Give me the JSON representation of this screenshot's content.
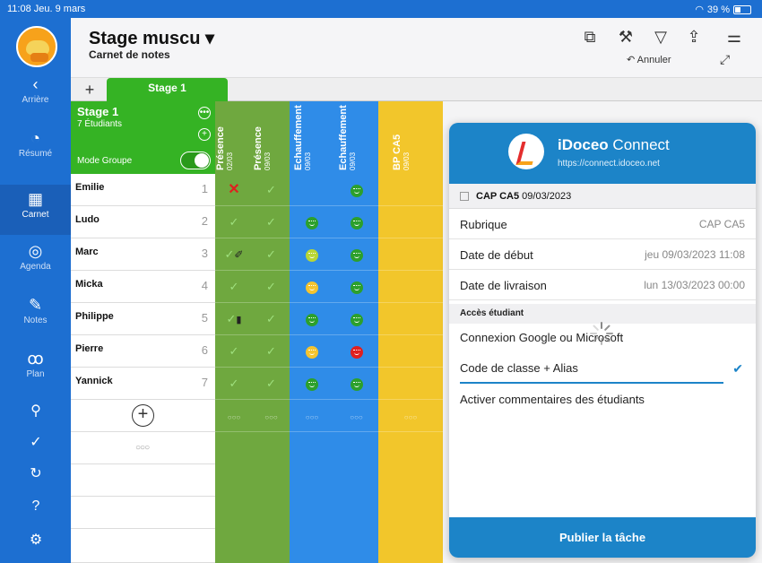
{
  "status": {
    "time": "11:08",
    "date": "Jeu. 9 mars",
    "battery": "39 %"
  },
  "sidebar": {
    "items": [
      {
        "label": "Arrière",
        "icon": "‹"
      },
      {
        "label": "Résumé",
        "icon": "◔"
      },
      {
        "label": "Carnet",
        "icon": "▦"
      },
      {
        "label": "Agenda",
        "icon": "◎"
      },
      {
        "label": "Notes",
        "icon": "✎"
      },
      {
        "label": "Plan",
        "icon": "ꝏ"
      }
    ],
    "active": "Carnet",
    "extra_icons": [
      "pin-icon",
      "check-circle-icon",
      "sync-icon",
      "help-icon",
      "settings-icon"
    ]
  },
  "header": {
    "title": "Stage muscu ▾",
    "subtitle": "Carnet de notes",
    "undo_label": "Annuler"
  },
  "tabs": {
    "add": "+",
    "active": "Stage 1"
  },
  "group": {
    "name": "Stage 1",
    "count": "7 Étudiants",
    "mode_label": "Mode Groupe",
    "mode_on": true
  },
  "students": [
    {
      "name": "Emilie",
      "num": "1"
    },
    {
      "name": "Ludo",
      "num": "2"
    },
    {
      "name": "Marc",
      "num": "3"
    },
    {
      "name": "Micka",
      "num": "4"
    },
    {
      "name": "Philippe",
      "num": "5"
    },
    {
      "name": "Pierre",
      "num": "6"
    },
    {
      "name": "Yannick",
      "num": "7"
    }
  ],
  "columns": [
    {
      "title": "Présence",
      "date": "02/03",
      "color": "#6fa83f"
    },
    {
      "title": "Présence",
      "date": "09/03",
      "color": "#6fa83f"
    },
    {
      "title": "Echauffement",
      "date": "09/03",
      "color": "#2f8ce8"
    },
    {
      "title": "Echauffement",
      "date": "09/03",
      "color": "#2f8ce8"
    },
    {
      "title": "BP CA5",
      "date": "09/03",
      "color": "#f2c62b"
    }
  ],
  "cells": [
    [
      "cross",
      "check",
      "",
      "green",
      ""
    ],
    [
      "check",
      "check",
      "green",
      "green",
      ""
    ],
    [
      "check-pen",
      "check",
      "lime",
      "green",
      ""
    ],
    [
      "check",
      "check",
      "yellow",
      "green",
      ""
    ],
    [
      "check-phone",
      "check",
      "green",
      "green",
      ""
    ],
    [
      "check",
      "check",
      "yellow",
      "red",
      ""
    ],
    [
      "check",
      "check",
      "green",
      "green",
      ""
    ]
  ],
  "panel": {
    "brand": "iDoceo",
    "brand_suffix": "Connect",
    "url": "https://connect.idoceo.net",
    "task": "CAP CA5",
    "task_date": "09/03/2023",
    "rows": [
      {
        "key": "Rubrique",
        "value": "CAP CA5"
      },
      {
        "key": "Date de début",
        "value": "jeu 09/03/2023 11:08"
      },
      {
        "key": "Date de livraison",
        "value": "lun 13/03/2023 00:00"
      }
    ],
    "section": "Accès étudiant",
    "options": [
      "Connexion Google ou Microsoft",
      "Code de classe + Alias",
      "Activer commentaires des étudiants"
    ],
    "publish": "Publier la tâche"
  }
}
